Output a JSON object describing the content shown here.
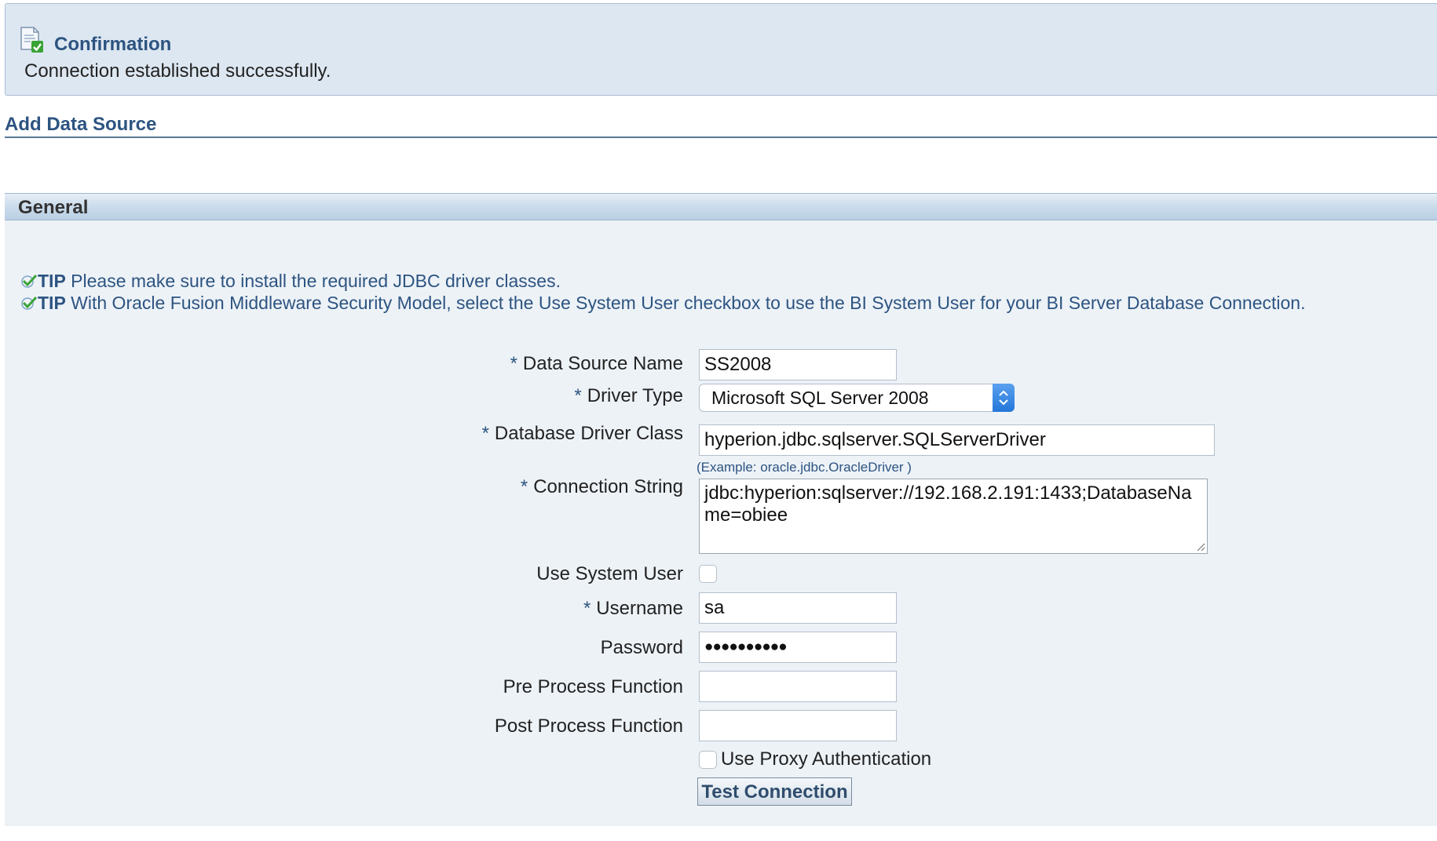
{
  "confirmation": {
    "title": "Confirmation",
    "message": "Connection established successfully.",
    "icon": "document-check-icon"
  },
  "page": {
    "title": "Add Data Source"
  },
  "panel": {
    "title": "General",
    "tips": [
      {
        "label": "TIP",
        "text": " Please make sure to install the required JDBC driver classes."
      },
      {
        "label": "TIP",
        "text": " With Oracle Fusion Middleware Security Model, select the Use System User checkbox to use the BI System User for your BI Server Database Connection."
      }
    ]
  },
  "form": {
    "required_mark": "*",
    "data_source_name": {
      "label": "Data Source Name",
      "value": "SS2008"
    },
    "driver_type": {
      "label": "Driver Type",
      "value": "Microsoft SQL Server 2008"
    },
    "database_driver_class": {
      "label": "Database Driver Class",
      "value": "hyperion.jdbc.sqlserver.SQLServerDriver",
      "example": "(Example: oracle.jdbc.OracleDriver )"
    },
    "connection_string": {
      "label": "Connection String",
      "value": "jdbc:hyperion:sqlserver://192.168.2.191:1433;DatabaseName=obiee"
    },
    "use_system_user": {
      "label": "Use System User",
      "checked": false
    },
    "username": {
      "label": "Username",
      "value": "sa"
    },
    "password": {
      "label": "Password",
      "value": "●●●●●●●●●●"
    },
    "pre_process_function": {
      "label": "Pre Process Function",
      "value": ""
    },
    "post_process_function": {
      "label": "Post Process Function",
      "value": ""
    },
    "use_proxy_authentication": {
      "label": "Use Proxy Authentication",
      "checked": false
    },
    "test_connection_label": "Test Connection"
  },
  "colors": {
    "accent": "#2d5481",
    "banner_bg": "#dde7f1",
    "panel_bg": "#edf2f7",
    "select_arrow": "#2377d9",
    "check_green": "#3aa335"
  }
}
